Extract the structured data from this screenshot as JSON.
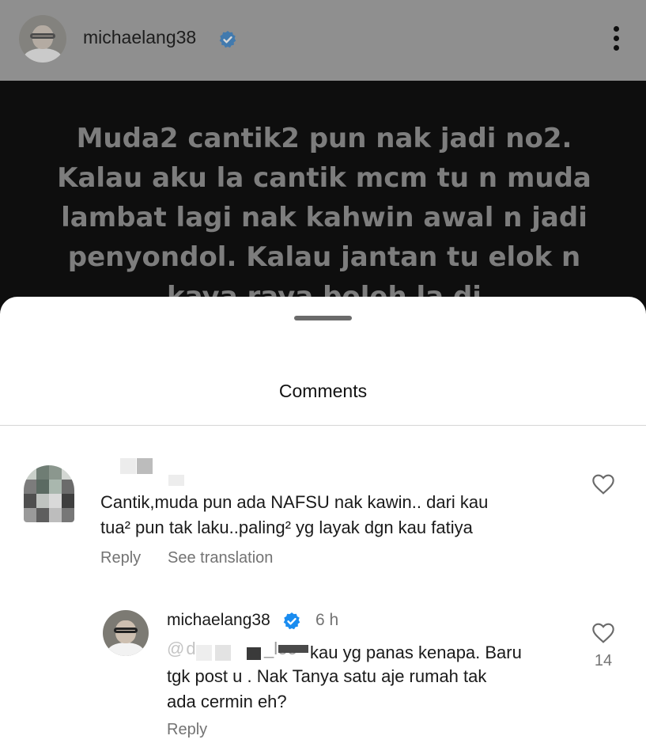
{
  "post": {
    "username": "michaelang38",
    "verified_icon": "verified-badge-icon",
    "menu_icon": "more-vertical-icon",
    "text_lines": [
      "Muda2 cantik2 pun nak jadi no2.",
      "Kalau aku la cantik mcm tu n muda",
      "lambat lagi nak kahwin awal n jadi",
      "penyondol. Kalau jantan tu elok n",
      "kaya raya boleh la di pertimbangkan"
    ]
  },
  "sheet": {
    "title": "Comments"
  },
  "comments": [
    {
      "username_redacted": true,
      "text_lines": [
        "Cantik,muda pun ada NAFSU nak kawin.. dari kau",
        "tua² pun tak laku..paling² yg layak dgn kau fatiya"
      ],
      "reply_label": "Reply",
      "translate_label": "See translation"
    }
  ],
  "reply": {
    "username": "michaelang38",
    "time": "6 h",
    "mention_redacted": "@d  _lee",
    "text_first": "kau yg panas kenapa. Baru",
    "text_lines": [
      "tgk post u . Nak Tanya satu aje rumah tak",
      "ada cermin eh?"
    ],
    "reply_label": "Reply",
    "like_count": "14"
  },
  "colors": {
    "accent_verified": "#1a8cf0",
    "secondary_text": "#737373"
  }
}
